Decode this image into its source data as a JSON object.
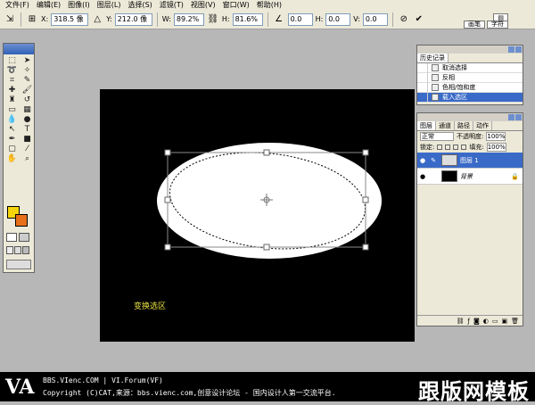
{
  "menu": [
    "文件(F)",
    "编辑(E)",
    "图像(I)",
    "图层(L)",
    "选择(S)",
    "滤镜(T)",
    "视图(V)",
    "窗口(W)",
    "帮助(H)"
  ],
  "options": {
    "x_label": "X:",
    "x_value": "318.5 像",
    "y_label": "Y:",
    "y_value": "212.0 像",
    "w_label": "W:",
    "w_value": "89.2%",
    "h_label": "H:",
    "h_value": "81.6%",
    "angle_value": "0.0",
    "hskew_label": "H:",
    "hskew_value": "0.0",
    "vskew_label": "V:",
    "vskew_value": "0.0",
    "wells": [
      "画笔",
      "字符"
    ]
  },
  "history": {
    "title": "历史记录",
    "items": [
      "取消选择",
      "反相",
      "色相/饱和度",
      "载入选区"
    ]
  },
  "layers": {
    "tabs": [
      "图层",
      "通道",
      "路径",
      "动作"
    ],
    "blend_mode": "正常",
    "opacity_label": "不透明度:",
    "opacity_value": "100%",
    "lock_label": "锁定:",
    "fill_label": "填充:",
    "fill_value": "100%",
    "items": [
      {
        "name": "图层 1"
      },
      {
        "name": "背景"
      }
    ]
  },
  "canvas": {
    "caption": "变换选区"
  },
  "footer": {
    "logo": "VA",
    "line1": "BBS.VIenc.COM | VI.Forum(VF)",
    "line2": "Copyright (C)CAT,来源：bbs.vienc.com,创意设计论坛 - 国内设计人第一交流平台.",
    "brand": "跟版网模板"
  },
  "colors": {
    "foreground": "#f5d60a",
    "background": "#e8701a",
    "selection": "#3a6ac8"
  }
}
